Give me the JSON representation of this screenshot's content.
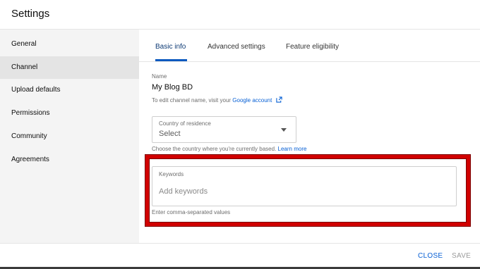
{
  "header": {
    "title": "Settings"
  },
  "sidebar": {
    "items": [
      {
        "label": "General",
        "active": false
      },
      {
        "label": "Channel",
        "active": true
      },
      {
        "label": "Upload defaults",
        "active": false
      },
      {
        "label": "Permissions",
        "active": false
      },
      {
        "label": "Community",
        "active": false
      },
      {
        "label": "Agreements",
        "active": false
      }
    ]
  },
  "tabs": [
    {
      "label": "Basic info",
      "active": true
    },
    {
      "label": "Advanced settings",
      "active": false
    },
    {
      "label": "Feature eligibility",
      "active": false
    }
  ],
  "basic_info": {
    "name_label": "Name",
    "name_value": "My Blog BD",
    "name_hint_prefix": "To edit channel name, visit your",
    "name_hint_link": "Google account",
    "country": {
      "label": "Country of residence",
      "value": "Select",
      "hint_prefix": "Choose the country where you're currently based.",
      "hint_link": "Learn more"
    },
    "keywords": {
      "label": "Keywords",
      "placeholder": "Add keywords",
      "value": "",
      "hint": "Enter comma-separated values"
    }
  },
  "footer": {
    "close_label": "CLOSE",
    "save_label": "SAVE"
  },
  "colors": {
    "accent": "#065fd4",
    "highlight": "#d10000",
    "sidebar_bg": "#f4f4f4",
    "sidebar_active": "#e4e4e4"
  },
  "icons": {
    "external_link": "external-link-icon",
    "dropdown": "caret-down-icon"
  }
}
